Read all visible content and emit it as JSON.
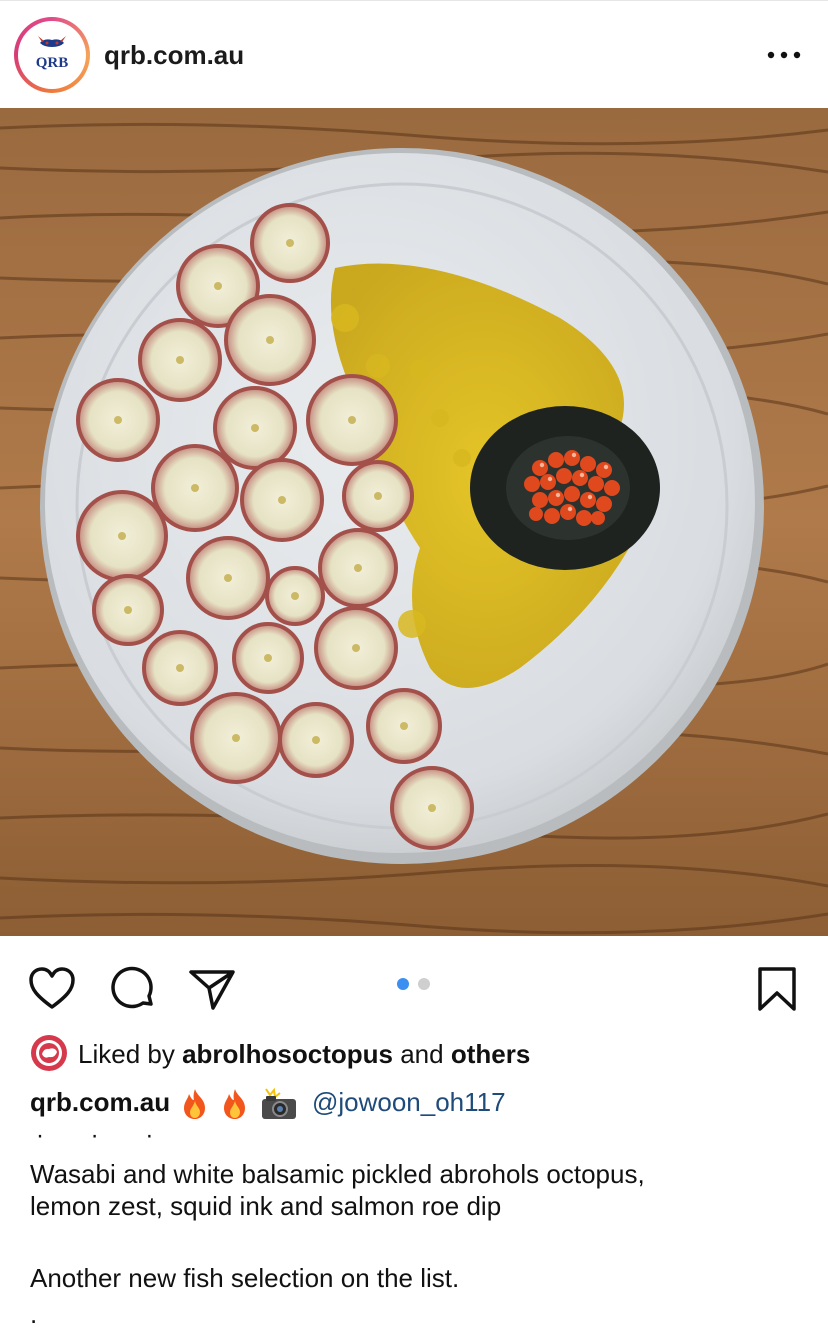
{
  "post": {
    "account_name": "qrb.com.au",
    "avatar_text": "QRB",
    "carousel": {
      "total": 2,
      "active": 1
    },
    "colors": {
      "accent_blue": "#3a8ff0",
      "inactive_dot": "#cfcfcf",
      "mention": "#1f4b7a"
    },
    "liked_by_prefix": "Liked by",
    "liked_by_user": "abrolhosoctopus",
    "liked_by_and": "and",
    "liked_by_others": "others",
    "caption_user": "qrb.com.au",
    "caption_emojis": [
      "🔥",
      "🔥",
      "📸"
    ],
    "caption_mention": "@jowoon_oh117",
    "caption_dots": "· · ·",
    "caption_lines": [
      "Wasabi and white balsamic pickled abrohols octopus,",
      "lemon zest, squid ink and salmon roe dip",
      "",
      "Another new fish selection on the list.",
      "."
    ]
  }
}
